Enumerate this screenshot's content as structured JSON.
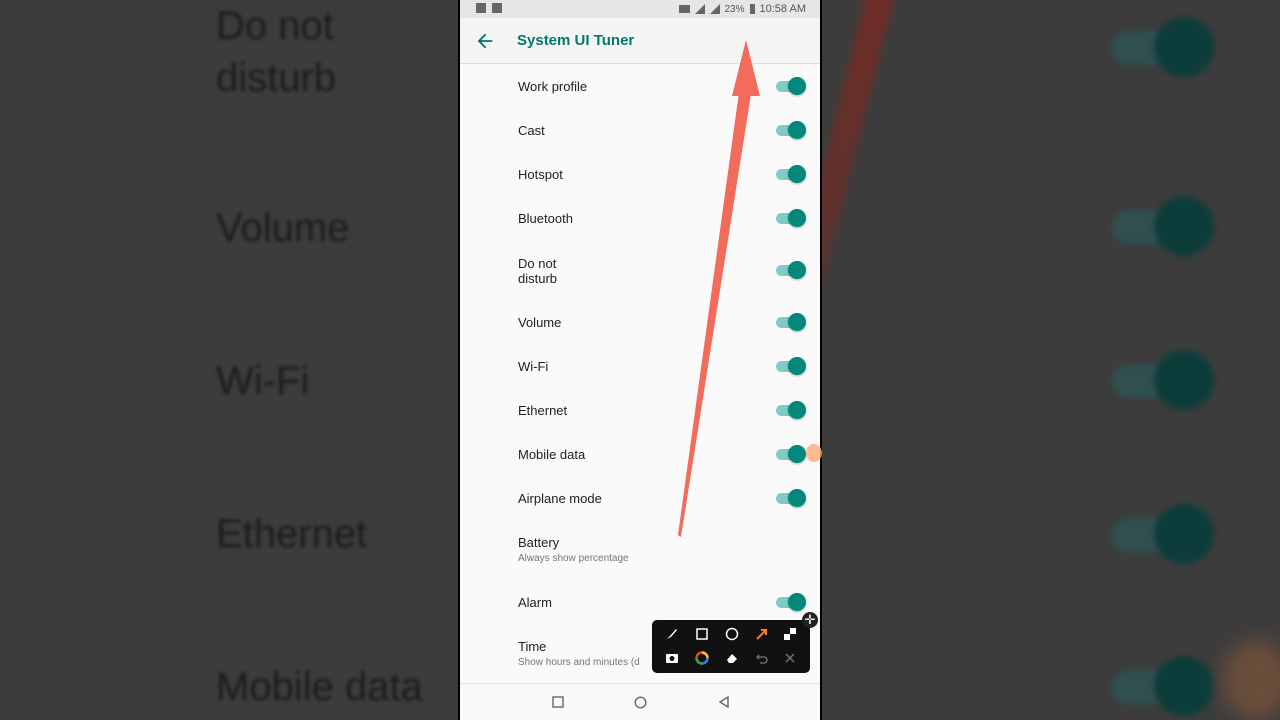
{
  "background": {
    "left_labels": [
      "Do not\ndisturb",
      "Volume",
      "Wi-Fi",
      "Ethernet",
      "Mobile data"
    ]
  },
  "statusbar": {
    "battery": "23%",
    "time": "10:58 AM"
  },
  "toolbar": {
    "title": "System UI Tuner"
  },
  "settings": [
    {
      "label": "Work profile",
      "summary": "",
      "toggle": true
    },
    {
      "label": "Cast",
      "summary": "",
      "toggle": true
    },
    {
      "label": "Hotspot",
      "summary": "",
      "toggle": true
    },
    {
      "label": "Bluetooth",
      "summary": "",
      "toggle": true
    },
    {
      "label": "Do not\ndisturb",
      "summary": "",
      "toggle": true
    },
    {
      "label": "Volume",
      "summary": "",
      "toggle": true
    },
    {
      "label": "Wi-Fi",
      "summary": "",
      "toggle": true
    },
    {
      "label": "Ethernet",
      "summary": "",
      "toggle": true
    },
    {
      "label": "Mobile data",
      "summary": "",
      "toggle": true
    },
    {
      "label": "Airplane mode",
      "summary": "",
      "toggle": true
    },
    {
      "label": "Battery",
      "summary": "Always show percentage",
      "toggle": null
    },
    {
      "label": "Alarm",
      "summary": "",
      "toggle": true
    },
    {
      "label": "Time",
      "summary": "Show hours and minutes (d",
      "toggle": null
    }
  ],
  "colors": {
    "accent": "#00796b",
    "toggle_thumb": "#00897b",
    "toggle_track": "#80cbc4",
    "annotation_arrow": "#f26b5b"
  },
  "annotation_toolbar": {
    "tools": [
      "brush-icon",
      "rectangle-icon",
      "circle-icon",
      "arrow-icon",
      "mosaic-icon",
      "camera-icon",
      "color-wheel-icon",
      "eraser-icon",
      "undo-icon",
      "close-icon"
    ]
  }
}
